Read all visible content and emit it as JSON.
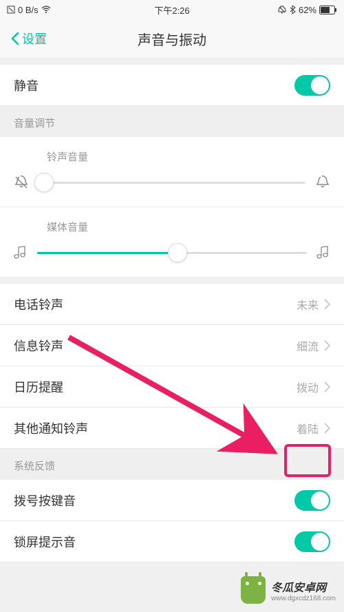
{
  "status": {
    "net_speed": "0 B/s",
    "time": "下午2:26",
    "battery": "62%"
  },
  "nav": {
    "back_label": "设置",
    "title": "声音与振动"
  },
  "mute": {
    "label": "静音"
  },
  "volume_section": {
    "header": "音量调节",
    "ringtone_label": "铃声音量",
    "ringtone_value": 2,
    "media_label": "媒体音量",
    "media_value": 52
  },
  "ringtones": {
    "phone": {
      "label": "电话铃声",
      "value": "未来"
    },
    "message": {
      "label": "信息铃声",
      "value": "细流"
    },
    "calendar": {
      "label": "日历提醒",
      "value": "拨动"
    },
    "other": {
      "label": "其他通知铃声",
      "value": "着陆"
    }
  },
  "feedback": {
    "header": "系统反馈",
    "dialpad": {
      "label": "拨号按键音"
    },
    "lockscreen": {
      "label": "锁屏提示音"
    }
  },
  "watermark": {
    "line1": "冬瓜安卓网",
    "line2": "www.dgxcdz168.com"
  }
}
